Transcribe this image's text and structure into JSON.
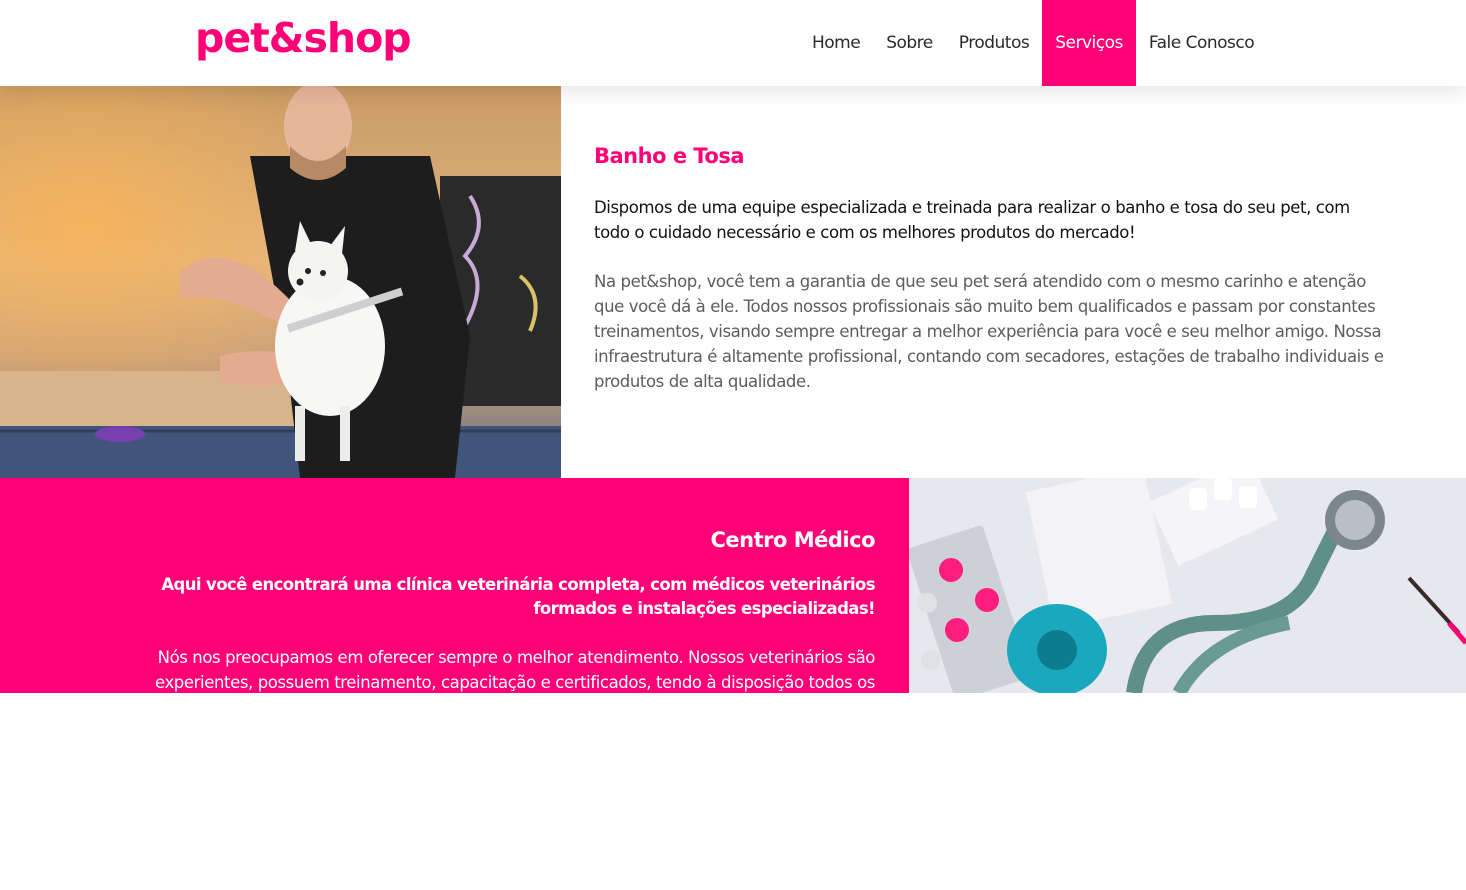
{
  "header": {
    "logo": "pet&shop",
    "nav": [
      {
        "label": "Home",
        "active": false
      },
      {
        "label": "Sobre",
        "active": false
      },
      {
        "label": "Produtos",
        "active": false
      },
      {
        "label": "Serviços",
        "active": true
      },
      {
        "label": "Fale Conosco",
        "active": false
      }
    ]
  },
  "grooming": {
    "title": "Banho e Tosa",
    "lead": "Dispomos de uma equipe especializada e treinada para realizar o banho e tosa do seu pet, com todo o cuidado necessário e com os melhores produtos do mercado!",
    "body": "Na pet&shop, você tem a garantia de que seu pet será atendido com o mesmo carinho e atenção que você dá à ele. Todos nossos profissionais são muito bem qualificados e passam por constantes treinamentos, visando sempre entregar a melhor experiência para você e seu melhor amigo. Nossa infraestrutura é altamente profissional, contando com secadores, estações de trabalho individuais e produtos de alta qualidade."
  },
  "medical": {
    "title": "Centro Médico",
    "lead": "Aqui você encontrará uma clínica veterinária completa, com médicos veterinários formados e instalações especializadas!",
    "body": "Nós nos preocupamos em oferecer sempre o melhor atendimento. Nossos veterinários são experientes, possuem treinamento, capacitação e certificados, tendo à disposição todos os"
  },
  "colors": {
    "accent": "#ff0077",
    "text_dark": "#111111",
    "text_muted": "#5c5c5c"
  }
}
